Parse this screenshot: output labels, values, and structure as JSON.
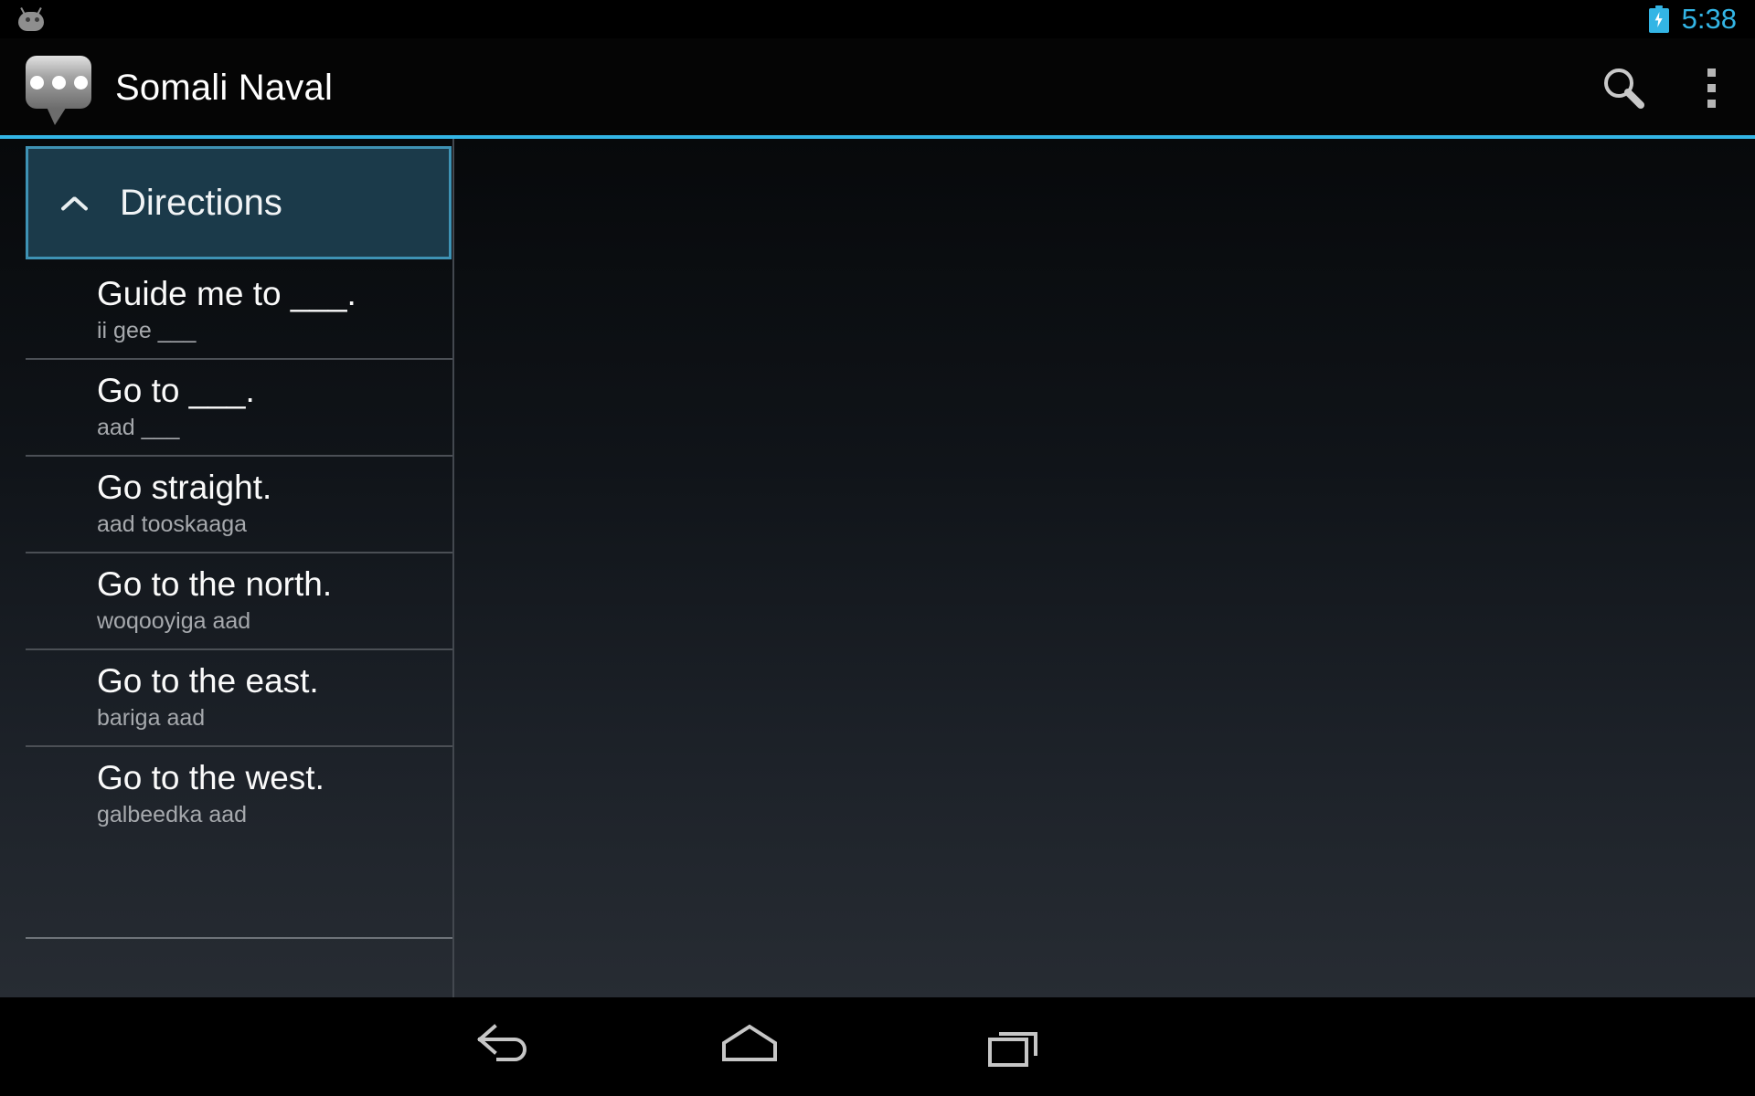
{
  "status_bar": {
    "android_icon": "bugdroid-icon",
    "battery_icon": "battery-charging-icon",
    "time": "5:38",
    "accent_color": "#33b5e5"
  },
  "action_bar": {
    "app_icon": "speech-bubble-icon",
    "title": "Somali Naval",
    "search_icon": "search-icon",
    "overflow_icon": "overflow-menu-icon",
    "underline_color": "#33b5e5"
  },
  "list_pane": {
    "group": {
      "label": "Directions",
      "expanded": true,
      "collapse_icon": "chevron-up-icon",
      "background_color": "#1b3a4a",
      "border_color": "#3e92b4"
    },
    "phrases": [
      {
        "en": "Guide me to ___.",
        "so": "ii gee ___"
      },
      {
        "en": "Go to ___.",
        "so": "aad ___"
      },
      {
        "en": "Go straight.",
        "so": "aad tooskaaga"
      },
      {
        "en": "Go to the north.",
        "so": "woqooyiga aad"
      },
      {
        "en": "Go to the east.",
        "so": "bariga aad"
      },
      {
        "en": "Go to the west.",
        "so": "galbeedka aad"
      }
    ]
  },
  "detail_pane": {
    "content": ""
  },
  "nav_bar": {
    "back_icon": "back-arrow-icon",
    "home_icon": "home-icon",
    "recents_icon": "recent-apps-icon"
  }
}
